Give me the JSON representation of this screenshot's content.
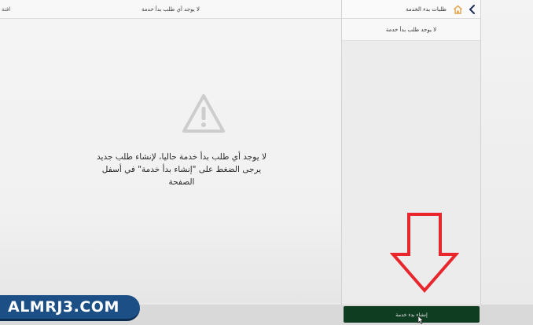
{
  "main": {
    "header_title": "لا يوجد أي طلب بدأ خدمة",
    "edge_label": "افتة",
    "empty_line1": "لا يوجد أي طلب بدأ خدمة حاليا، لإنشاء طلب جديد",
    "empty_line2": "يرجى الضغط على \"إنشاء بدأ خدمة\" في أسفل",
    "empty_line3": "الصفحة",
    "warning_icon": "warning-triangle-icon"
  },
  "sidebar": {
    "title": "طلبات بدء الخدمة",
    "subtitle": "لا يوجد طلب بدأ خدمة",
    "back_icon": "chevron-left-icon",
    "home_icon": "home-icon",
    "create_button_label": "إنشاء بدء خدمة"
  },
  "watermark": {
    "text": "ALMRJ3.COM"
  },
  "colors": {
    "button_green": "#0f3d22",
    "annotation_red": "#e8262b",
    "logo_blue": "#1b4f86",
    "home_orange": "#e0a144"
  }
}
